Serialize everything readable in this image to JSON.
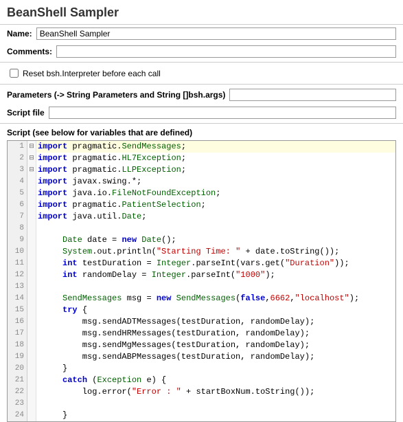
{
  "header": "BeanShell Sampler",
  "nameLabel": "Name:",
  "nameValue": "BeanShell Sampler",
  "commentsLabel": "Comments:",
  "resetLabel": "Reset bsh.Interpreter before each call",
  "paramsLabel": "Parameters (-> String Parameters and String []bsh.args)",
  "scriptFileLabel": "Script file",
  "scriptLabel": "Script (see below for variables that are defined)",
  "code": {
    "lines": [
      {
        "n": 1,
        "fold": "⊟",
        "hl": true,
        "tokens": [
          [
            "kw",
            "import"
          ],
          [
            "id",
            " pragmatic."
          ],
          [
            "type",
            "SendMessages"
          ],
          [
            "id",
            ";"
          ]
        ]
      },
      {
        "n": 2,
        "tokens": [
          [
            "kw",
            "import"
          ],
          [
            "id",
            " pragmatic."
          ],
          [
            "type",
            "HL7Exception"
          ],
          [
            "id",
            ";"
          ]
        ]
      },
      {
        "n": 3,
        "tokens": [
          [
            "kw",
            "import"
          ],
          [
            "id",
            " pragmatic."
          ],
          [
            "type",
            "LLPException"
          ],
          [
            "id",
            ";"
          ]
        ]
      },
      {
        "n": 4,
        "tokens": [
          [
            "kw",
            "import"
          ],
          [
            "id",
            " javax.swing.*;"
          ]
        ]
      },
      {
        "n": 5,
        "tokens": [
          [
            "kw",
            "import"
          ],
          [
            "id",
            " java.io."
          ],
          [
            "type",
            "FileNotFoundException"
          ],
          [
            "id",
            ";"
          ]
        ]
      },
      {
        "n": 6,
        "tokens": [
          [
            "kw",
            "import"
          ],
          [
            "id",
            " pragmatic."
          ],
          [
            "type",
            "PatientSelection"
          ],
          [
            "id",
            ";"
          ]
        ]
      },
      {
        "n": 7,
        "tokens": [
          [
            "kw",
            "import"
          ],
          [
            "id",
            " java.util."
          ],
          [
            "type",
            "Date"
          ],
          [
            "id",
            ";"
          ]
        ]
      },
      {
        "n": 8,
        "tokens": []
      },
      {
        "n": 9,
        "tokens": [
          [
            "id",
            "     "
          ],
          [
            "type",
            "Date"
          ],
          [
            "id",
            " date = "
          ],
          [
            "kw",
            "new"
          ],
          [
            "id",
            " "
          ],
          [
            "type",
            "Date"
          ],
          [
            "id",
            "();"
          ]
        ]
      },
      {
        "n": 10,
        "tokens": [
          [
            "id",
            "     "
          ],
          [
            "type",
            "System"
          ],
          [
            "id",
            ".out.println("
          ],
          [
            "str",
            "\"Starting Time: \""
          ],
          [
            "id",
            " + date.toString());"
          ]
        ]
      },
      {
        "n": 11,
        "tokens": [
          [
            "id",
            "     "
          ],
          [
            "kw",
            "int"
          ],
          [
            "id",
            " testDuration = "
          ],
          [
            "type",
            "Integer"
          ],
          [
            "id",
            ".parseInt(vars.get("
          ],
          [
            "str",
            "\"Duration\""
          ],
          [
            "id",
            "));"
          ]
        ]
      },
      {
        "n": 12,
        "tokens": [
          [
            "id",
            "     "
          ],
          [
            "kw",
            "int"
          ],
          [
            "id",
            " randomDelay = "
          ],
          [
            "type",
            "Integer"
          ],
          [
            "id",
            ".parseInt("
          ],
          [
            "str",
            "\"1000\""
          ],
          [
            "id",
            ");"
          ]
        ]
      },
      {
        "n": 13,
        "tokens": []
      },
      {
        "n": 14,
        "tokens": [
          [
            "id",
            "     "
          ],
          [
            "type",
            "SendMessages"
          ],
          [
            "id",
            " msg = "
          ],
          [
            "kw",
            "new"
          ],
          [
            "id",
            " "
          ],
          [
            "type",
            "SendMessages"
          ],
          [
            "id",
            "("
          ],
          [
            "kw",
            "false"
          ],
          [
            "id",
            ","
          ],
          [
            "num",
            "6662"
          ],
          [
            "id",
            ","
          ],
          [
            "str",
            "\"localhost\""
          ],
          [
            "id",
            ");"
          ]
        ]
      },
      {
        "n": 15,
        "fold": "⊟",
        "tokens": [
          [
            "id",
            "     "
          ],
          [
            "kw",
            "try"
          ],
          [
            "id",
            " {"
          ]
        ]
      },
      {
        "n": 16,
        "tokens": [
          [
            "id",
            "         msg.sendADTMessages(testDuration, randomDelay);"
          ]
        ]
      },
      {
        "n": 17,
        "tokens": [
          [
            "id",
            "         msg.sendHRMessages(testDuration, randomDelay);"
          ]
        ]
      },
      {
        "n": 18,
        "tokens": [
          [
            "id",
            "         msg.sendMgMessages(testDuration, randomDelay);"
          ]
        ]
      },
      {
        "n": 19,
        "tokens": [
          [
            "id",
            "         msg.sendABPMessages(testDuration, randomDelay);"
          ]
        ]
      },
      {
        "n": 20,
        "tokens": [
          [
            "id",
            "     }"
          ]
        ]
      },
      {
        "n": 21,
        "fold": "⊟",
        "tokens": [
          [
            "id",
            "     "
          ],
          [
            "kw",
            "catch"
          ],
          [
            "id",
            " ("
          ],
          [
            "type",
            "Exception"
          ],
          [
            "id",
            " e) {"
          ]
        ]
      },
      {
        "n": 22,
        "tokens": [
          [
            "id",
            "         log.error("
          ],
          [
            "str",
            "\"Error : \""
          ],
          [
            "id",
            " + startBoxNum.toString());"
          ]
        ]
      },
      {
        "n": 23,
        "tokens": []
      },
      {
        "n": 24,
        "tokens": [
          [
            "id",
            "     }"
          ]
        ]
      }
    ]
  }
}
